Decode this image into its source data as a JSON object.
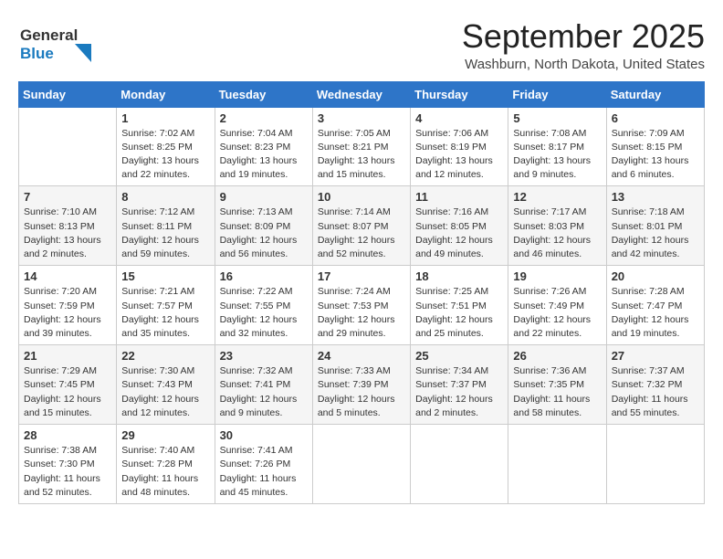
{
  "logo": {
    "line1": "General",
    "line2": "Blue",
    "arrow_color": "#1a7abf"
  },
  "title": "September 2025",
  "location": "Washburn, North Dakota, United States",
  "days_of_week": [
    "Sunday",
    "Monday",
    "Tuesday",
    "Wednesday",
    "Thursday",
    "Friday",
    "Saturday"
  ],
  "weeks": [
    [
      {
        "day": "",
        "sunrise": "",
        "sunset": "",
        "daylight": ""
      },
      {
        "day": "1",
        "sunrise": "Sunrise: 7:02 AM",
        "sunset": "Sunset: 8:25 PM",
        "daylight": "Daylight: 13 hours and 22 minutes."
      },
      {
        "day": "2",
        "sunrise": "Sunrise: 7:04 AM",
        "sunset": "Sunset: 8:23 PM",
        "daylight": "Daylight: 13 hours and 19 minutes."
      },
      {
        "day": "3",
        "sunrise": "Sunrise: 7:05 AM",
        "sunset": "Sunset: 8:21 PM",
        "daylight": "Daylight: 13 hours and 15 minutes."
      },
      {
        "day": "4",
        "sunrise": "Sunrise: 7:06 AM",
        "sunset": "Sunset: 8:19 PM",
        "daylight": "Daylight: 13 hours and 12 minutes."
      },
      {
        "day": "5",
        "sunrise": "Sunrise: 7:08 AM",
        "sunset": "Sunset: 8:17 PM",
        "daylight": "Daylight: 13 hours and 9 minutes."
      },
      {
        "day": "6",
        "sunrise": "Sunrise: 7:09 AM",
        "sunset": "Sunset: 8:15 PM",
        "daylight": "Daylight: 13 hours and 6 minutes."
      }
    ],
    [
      {
        "day": "7",
        "sunrise": "Sunrise: 7:10 AM",
        "sunset": "Sunset: 8:13 PM",
        "daylight": "Daylight: 13 hours and 2 minutes."
      },
      {
        "day": "8",
        "sunrise": "Sunrise: 7:12 AM",
        "sunset": "Sunset: 8:11 PM",
        "daylight": "Daylight: 12 hours and 59 minutes."
      },
      {
        "day": "9",
        "sunrise": "Sunrise: 7:13 AM",
        "sunset": "Sunset: 8:09 PM",
        "daylight": "Daylight: 12 hours and 56 minutes."
      },
      {
        "day": "10",
        "sunrise": "Sunrise: 7:14 AM",
        "sunset": "Sunset: 8:07 PM",
        "daylight": "Daylight: 12 hours and 52 minutes."
      },
      {
        "day": "11",
        "sunrise": "Sunrise: 7:16 AM",
        "sunset": "Sunset: 8:05 PM",
        "daylight": "Daylight: 12 hours and 49 minutes."
      },
      {
        "day": "12",
        "sunrise": "Sunrise: 7:17 AM",
        "sunset": "Sunset: 8:03 PM",
        "daylight": "Daylight: 12 hours and 46 minutes."
      },
      {
        "day": "13",
        "sunrise": "Sunrise: 7:18 AM",
        "sunset": "Sunset: 8:01 PM",
        "daylight": "Daylight: 12 hours and 42 minutes."
      }
    ],
    [
      {
        "day": "14",
        "sunrise": "Sunrise: 7:20 AM",
        "sunset": "Sunset: 7:59 PM",
        "daylight": "Daylight: 12 hours and 39 minutes."
      },
      {
        "day": "15",
        "sunrise": "Sunrise: 7:21 AM",
        "sunset": "Sunset: 7:57 PM",
        "daylight": "Daylight: 12 hours and 35 minutes."
      },
      {
        "day": "16",
        "sunrise": "Sunrise: 7:22 AM",
        "sunset": "Sunset: 7:55 PM",
        "daylight": "Daylight: 12 hours and 32 minutes."
      },
      {
        "day": "17",
        "sunrise": "Sunrise: 7:24 AM",
        "sunset": "Sunset: 7:53 PM",
        "daylight": "Daylight: 12 hours and 29 minutes."
      },
      {
        "day": "18",
        "sunrise": "Sunrise: 7:25 AM",
        "sunset": "Sunset: 7:51 PM",
        "daylight": "Daylight: 12 hours and 25 minutes."
      },
      {
        "day": "19",
        "sunrise": "Sunrise: 7:26 AM",
        "sunset": "Sunset: 7:49 PM",
        "daylight": "Daylight: 12 hours and 22 minutes."
      },
      {
        "day": "20",
        "sunrise": "Sunrise: 7:28 AM",
        "sunset": "Sunset: 7:47 PM",
        "daylight": "Daylight: 12 hours and 19 minutes."
      }
    ],
    [
      {
        "day": "21",
        "sunrise": "Sunrise: 7:29 AM",
        "sunset": "Sunset: 7:45 PM",
        "daylight": "Daylight: 12 hours and 15 minutes."
      },
      {
        "day": "22",
        "sunrise": "Sunrise: 7:30 AM",
        "sunset": "Sunset: 7:43 PM",
        "daylight": "Daylight: 12 hours and 12 minutes."
      },
      {
        "day": "23",
        "sunrise": "Sunrise: 7:32 AM",
        "sunset": "Sunset: 7:41 PM",
        "daylight": "Daylight: 12 hours and 9 minutes."
      },
      {
        "day": "24",
        "sunrise": "Sunrise: 7:33 AM",
        "sunset": "Sunset: 7:39 PM",
        "daylight": "Daylight: 12 hours and 5 minutes."
      },
      {
        "day": "25",
        "sunrise": "Sunrise: 7:34 AM",
        "sunset": "Sunset: 7:37 PM",
        "daylight": "Daylight: 12 hours and 2 minutes."
      },
      {
        "day": "26",
        "sunrise": "Sunrise: 7:36 AM",
        "sunset": "Sunset: 7:35 PM",
        "daylight": "Daylight: 11 hours and 58 minutes."
      },
      {
        "day": "27",
        "sunrise": "Sunrise: 7:37 AM",
        "sunset": "Sunset: 7:32 PM",
        "daylight": "Daylight: 11 hours and 55 minutes."
      }
    ],
    [
      {
        "day": "28",
        "sunrise": "Sunrise: 7:38 AM",
        "sunset": "Sunset: 7:30 PM",
        "daylight": "Daylight: 11 hours and 52 minutes."
      },
      {
        "day": "29",
        "sunrise": "Sunrise: 7:40 AM",
        "sunset": "Sunset: 7:28 PM",
        "daylight": "Daylight: 11 hours and 48 minutes."
      },
      {
        "day": "30",
        "sunrise": "Sunrise: 7:41 AM",
        "sunset": "Sunset: 7:26 PM",
        "daylight": "Daylight: 11 hours and 45 minutes."
      },
      {
        "day": "",
        "sunrise": "",
        "sunset": "",
        "daylight": ""
      },
      {
        "day": "",
        "sunrise": "",
        "sunset": "",
        "daylight": ""
      },
      {
        "day": "",
        "sunrise": "",
        "sunset": "",
        "daylight": ""
      },
      {
        "day": "",
        "sunrise": "",
        "sunset": "",
        "daylight": ""
      }
    ]
  ]
}
